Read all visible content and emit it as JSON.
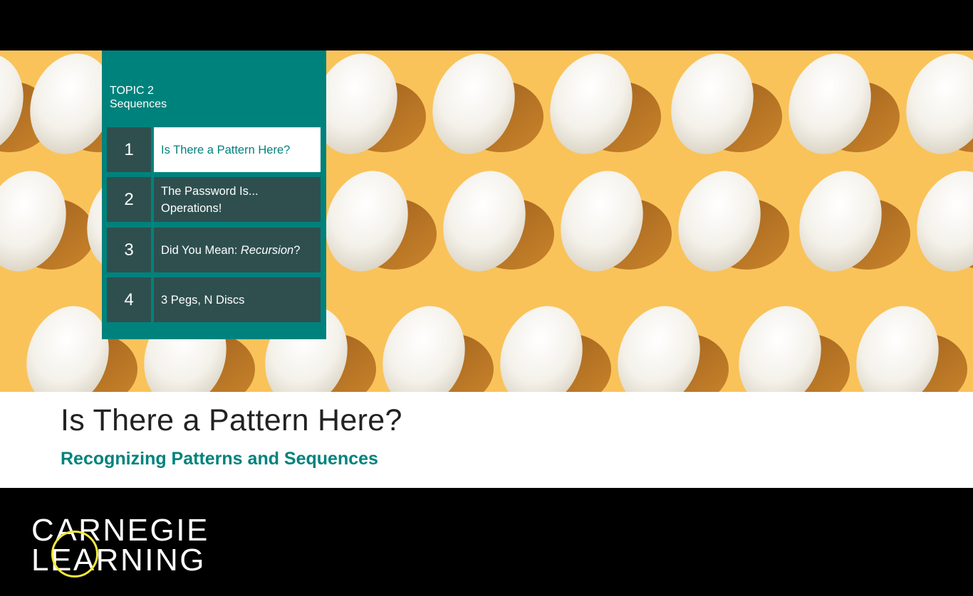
{
  "topic": {
    "line1": "TOPIC 2",
    "line2": "Sequences"
  },
  "lessons": [
    {
      "number": "1",
      "title": "Is There a Pattern Here?"
    },
    {
      "number": "2",
      "title_line1": "The Password Is...",
      "title_line2": "Operations!"
    },
    {
      "number": "3",
      "title_prefix": "Did You Mean: ",
      "title_emph": "Recursion",
      "title_suffix": "?"
    },
    {
      "number": "4",
      "title": "3 Pegs, N Discs"
    }
  ],
  "page": {
    "title": "Is There a Pattern Here?",
    "subtitle": "Recognizing Patterns and Sequences"
  },
  "logo": {
    "line1": "CARNEGIE",
    "line2": "LEARNING"
  },
  "colors": {
    "teal": "#00827c",
    "dark_teal": "#2f4f4f",
    "egg_background": "#f9c35a",
    "logo_ring": "#f5ea3a"
  }
}
